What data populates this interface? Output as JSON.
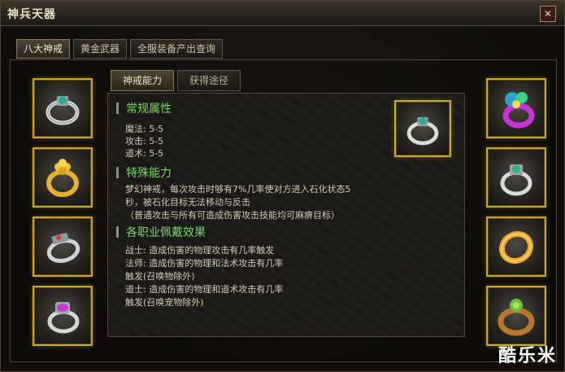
{
  "window": {
    "title": "神兵天器"
  },
  "top_tabs": [
    {
      "label": "八大神戒"
    },
    {
      "label": "黄金武器"
    },
    {
      "label": "全服装备产出查询"
    }
  ],
  "sub_tabs": [
    {
      "label": "神戒能力"
    },
    {
      "label": "获得途径"
    }
  ],
  "sections": {
    "basic": {
      "title": "常规属性",
      "lines": [
        "魔法: 5-5",
        "攻击: 5-5",
        "道术: 5-5"
      ]
    },
    "special": {
      "title": "特殊能力",
      "lines": [
        "梦幻神戒，每次攻击时够有7%几率使对方进入石化状态5",
        "秒，被石化目标无法移动与反击",
        "（普通攻击与所有可造成伤害攻击技能均可麻痹目标）"
      ]
    },
    "class_effects": {
      "title": "各职业佩戴效果",
      "lines": [
        "战士: 造成伤害的物理攻击有几率触发",
        "法师: 造成伤害的物理和法术攻击有几率",
        "触发(召唤物除外)",
        "道士: 造成伤害的物理和道术攻击有几率",
        "触发(召唤宠物除外)"
      ]
    }
  },
  "rings_left": [
    {
      "icon": "silver-ring-teal-gem-icon"
    },
    {
      "icon": "gold-ring-icon"
    },
    {
      "icon": "silver-ring-red-gem-icon"
    },
    {
      "icon": "silver-ring-purple-gem-icon"
    }
  ],
  "rings_right": [
    {
      "icon": "purple-ring-icon"
    },
    {
      "icon": "silver-ring-green-gem-icon"
    },
    {
      "icon": "gold-band-ring-icon"
    },
    {
      "icon": "bronze-ring-green-gem-icon"
    }
  ],
  "selected_ring": {
    "icon": "selected-ring-preview-icon"
  },
  "watermark": "酷乐米",
  "colors": {
    "section_title": "#7fd26b",
    "slot_border": "#c9a530"
  }
}
